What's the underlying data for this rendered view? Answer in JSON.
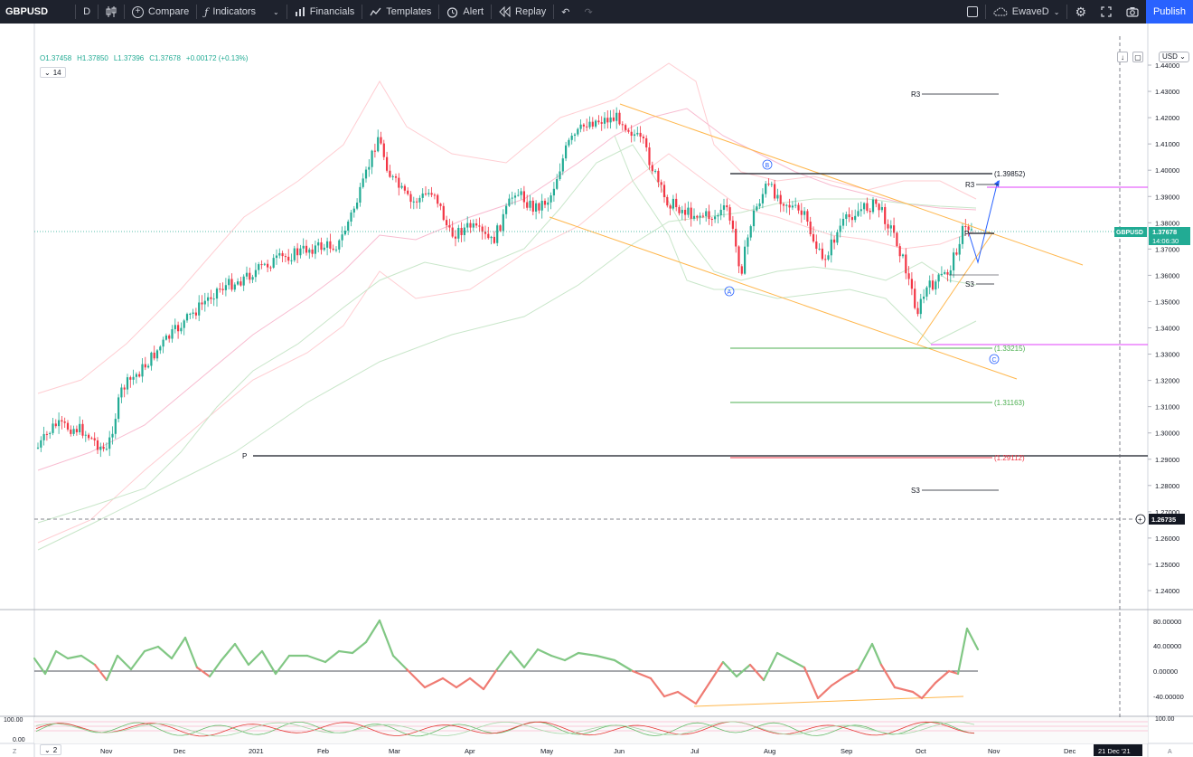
{
  "toolbar": {
    "symbol": "GBPUSD",
    "interval": "D",
    "compare": "Compare",
    "indicators": "Indicators",
    "financials": "Financials",
    "templates": "Templates",
    "alert": "Alert",
    "replay": "Replay",
    "layout_name": "EwaveD",
    "publish": "Publish"
  },
  "legend": {
    "open": "O1.37458",
    "high": "H1.37850",
    "low": "L1.37396",
    "close": "C1.37678",
    "change": "+0.00172 (+0.13%)",
    "indicator_input": "14",
    "lower_indicator_input": "2"
  },
  "price_axis": {
    "currency": "USD",
    "ticks": [
      "1.44000",
      "1.43000",
      "1.42000",
      "1.41000",
      "1.40000",
      "1.39000",
      "1.38000",
      "1.37000",
      "1.36000",
      "1.35000",
      "1.34000",
      "1.33000",
      "1.32000",
      "1.31000",
      "1.30000",
      "1.29000",
      "1.28000",
      "1.27000",
      "1.26000",
      "1.25000",
      "1.24000"
    ],
    "symbol_tag": "GBPUSD",
    "last_price": "1.37678",
    "countdown": "14:06:30",
    "crosshair_price": "1.26735"
  },
  "rsi_axis": {
    "ticks": [
      "80.00000",
      "40.00000",
      "0.00000",
      "-40.00000"
    ]
  },
  "stoch_axis": {
    "left_ticks": [
      "100.00",
      "0.00"
    ],
    "right_tick": "100.00"
  },
  "time_axis": {
    "labels": [
      "Nov",
      "Dec",
      "2021",
      "Feb",
      "Mar",
      "Apr",
      "May",
      "Jun",
      "Jul",
      "Aug",
      "Sep",
      "Oct",
      "Nov",
      "Dec"
    ],
    "crosshair_date": "21 Dec '21",
    "left_corner": "Z",
    "right_corner": "A"
  },
  "annotations": {
    "wave_A": "A",
    "wave_B": "B",
    "wave_C": "C",
    "fib_top": "(1.39852)",
    "fib_mid": "(1.33215)",
    "fib_low": "(1.31163)",
    "fib_red": "(1.29112)",
    "pivot_R3_top": "R3",
    "pivot_R3_right": "R3",
    "pivot_S3_right": "S3",
    "pivot_S3_low": "S3",
    "pivot_P_left": "P",
    "pivot_P_right": "P"
  },
  "colors": {
    "up": "#22ab94",
    "down": "#f23645",
    "channel": "#ffb74d",
    "toolbar_bg": "#1e222d",
    "publish": "#2962ff",
    "oscillator_up": "#81c784",
    "oscillator_down": "#ef7b73"
  }
}
